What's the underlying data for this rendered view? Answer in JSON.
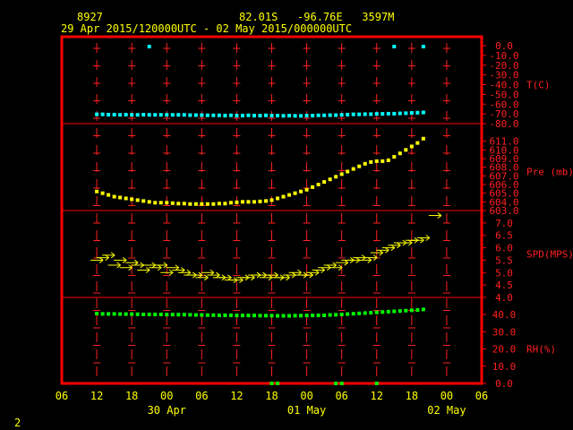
{
  "header": {
    "station": "8927",
    "location": "82.01S   -96.76E   3597M",
    "period": "29 Apr 2015/120000UTC - 02 May 2015/000000UTC"
  },
  "footer": {
    "page_number": "2"
  },
  "chart_data": {
    "type": "scatter",
    "x_axis": {
      "unit": "hours from 29 Apr 2015 06 UTC",
      "range": [
        0,
        72
      ],
      "tick_labels": [
        {
          "h": 0,
          "label": "06"
        },
        {
          "h": 6,
          "label": "12"
        },
        {
          "h": 12,
          "label": "18"
        },
        {
          "h": 18,
          "label": "00"
        },
        {
          "h": 24,
          "label": "06"
        },
        {
          "h": 30,
          "label": "12"
        },
        {
          "h": 36,
          "label": "18"
        },
        {
          "h": 42,
          "label": "00"
        },
        {
          "h": 48,
          "label": "06"
        },
        {
          "h": 54,
          "label": "12"
        },
        {
          "h": 60,
          "label": "18"
        },
        {
          "h": 66,
          "label": "00"
        },
        {
          "h": 72,
          "label": "06"
        }
      ],
      "date_labels": [
        {
          "h": 18,
          "label": "30 Apr"
        },
        {
          "h": 42,
          "label": "01 May"
        },
        {
          "h": 66,
          "label": "02 May"
        }
      ]
    },
    "panels": [
      {
        "id": "temp",
        "label": "T(C)",
        "color": "#00ffff",
        "ylim": [
          -80,
          0
        ],
        "tick_labels": [
          "0.0",
          "-10.0",
          "-20.0",
          "-30.0",
          "-40.0",
          "-50.0",
          "-60.0",
          "-70.0",
          "-80.0"
        ],
        "tick_values": [
          0,
          -10,
          -20,
          -30,
          -40,
          -50,
          -60,
          -70,
          -80
        ],
        "values": [
          [
            6,
            -70.5
          ],
          [
            7,
            -70.5
          ],
          [
            8,
            -70.8
          ],
          [
            9,
            -70.8
          ],
          [
            10,
            -71
          ],
          [
            11,
            -70.8
          ],
          [
            12,
            -71
          ],
          [
            13,
            -71
          ],
          [
            14,
            -70.8
          ],
          [
            15,
            -71
          ],
          [
            16,
            -71
          ],
          [
            17,
            -71
          ],
          [
            18,
            -71
          ],
          [
            19,
            -71
          ],
          [
            20,
            -71
          ],
          [
            21,
            -71
          ],
          [
            22,
            -71.3
          ],
          [
            23,
            -71.3
          ],
          [
            24,
            -71.3
          ],
          [
            25,
            -71.5
          ],
          [
            26,
            -71.5
          ],
          [
            27,
            -71.5
          ],
          [
            28,
            -71.8
          ],
          [
            29,
            -71.5
          ],
          [
            30,
            -71.8
          ],
          [
            31,
            -71.8
          ],
          [
            32,
            -71.5
          ],
          [
            33,
            -71.8
          ],
          [
            34,
            -71.8
          ],
          [
            35,
            -71.5
          ],
          [
            36,
            -71.8
          ],
          [
            37,
            -71.8
          ],
          [
            38,
            -72
          ],
          [
            39,
            -71.8
          ],
          [
            40,
            -72
          ],
          [
            41,
            -72
          ],
          [
            42,
            -71.8
          ],
          [
            43,
            -71.8
          ],
          [
            44,
            -71.5
          ],
          [
            45,
            -71.5
          ],
          [
            46,
            -71.3
          ],
          [
            47,
            -71.3
          ],
          [
            48,
            -71
          ],
          [
            49,
            -70.8
          ],
          [
            50,
            -70.5
          ],
          [
            51,
            -70.5
          ],
          [
            52,
            -70.3
          ],
          [
            53,
            -70.3
          ],
          [
            54,
            -70
          ],
          [
            55,
            -70
          ],
          [
            56,
            -69.8
          ],
          [
            57,
            -69.8
          ],
          [
            58,
            -69.5
          ],
          [
            59,
            -69.3
          ],
          [
            60,
            -69
          ],
          [
            61,
            -68.8
          ],
          [
            62,
            -68.5
          ]
        ],
        "top_markers": [
          15,
          57,
          62
        ]
      },
      {
        "id": "pres",
        "label": "Pre (mb)",
        "color": "#ffff00",
        "ylim": [
          603,
          612
        ],
        "tick_labels": [
          "611.0",
          "610.0",
          "609.0",
          "608.0",
          "607.0",
          "606.0",
          "605.0",
          "604.0",
          "603.0"
        ],
        "tick_values": [
          611,
          610,
          609,
          608,
          607,
          606,
          605,
          604,
          603
        ],
        "values": [
          [
            6,
            605.2
          ],
          [
            7,
            605
          ],
          [
            8,
            604.8
          ],
          [
            9,
            604.6
          ],
          [
            10,
            604.5
          ],
          [
            11,
            604.4
          ],
          [
            12,
            604.3
          ],
          [
            13,
            604.2
          ],
          [
            14,
            604.1
          ],
          [
            15,
            604
          ],
          [
            16,
            603.9
          ],
          [
            17,
            603.9
          ],
          [
            18,
            603.9
          ],
          [
            19,
            603.85
          ],
          [
            20,
            603.8
          ],
          [
            21,
            603.8
          ],
          [
            22,
            603.75
          ],
          [
            23,
            603.75
          ],
          [
            24,
            603.75
          ],
          [
            25,
            603.75
          ],
          [
            26,
            603.75
          ],
          [
            27,
            603.8
          ],
          [
            28,
            603.8
          ],
          [
            29,
            603.9
          ],
          [
            30,
            603.95
          ],
          [
            31,
            604
          ],
          [
            32,
            604
          ],
          [
            33,
            604
          ],
          [
            34,
            604.05
          ],
          [
            35,
            604.1
          ],
          [
            36,
            604.2
          ],
          [
            37,
            604.4
          ],
          [
            38,
            604.6
          ],
          [
            39,
            604.8
          ],
          [
            40,
            605
          ],
          [
            41,
            605.2
          ],
          [
            42,
            605.4
          ],
          [
            43,
            605.7
          ],
          [
            44,
            606
          ],
          [
            45,
            606.3
          ],
          [
            46,
            606.6
          ],
          [
            47,
            606.9
          ],
          [
            48,
            607.2
          ],
          [
            49,
            607.5
          ],
          [
            50,
            607.8
          ],
          [
            51,
            608.1
          ],
          [
            52,
            608.4
          ],
          [
            53,
            608.6
          ],
          [
            54,
            608.7
          ],
          [
            55,
            608.7
          ],
          [
            56,
            608.8
          ],
          [
            57,
            609.2
          ],
          [
            58,
            609.6
          ],
          [
            59,
            610
          ],
          [
            60,
            610.4
          ],
          [
            61,
            610.8
          ],
          [
            62,
            611.3
          ]
        ]
      },
      {
        "id": "wind",
        "label": "SPD(MPS)",
        "color": "#ffff00",
        "ylim": [
          4,
          7.5
        ],
        "tick_labels": [
          "7.0",
          "6.5",
          "6.0",
          "5.5",
          "5.0",
          "4.5",
          "4.0"
        ],
        "tick_values": [
          7,
          6.5,
          6,
          5.5,
          5,
          4.5,
          4
        ],
        "values": [
          [
            6,
            5.5
          ],
          [
            7,
            5.6
          ],
          [
            8,
            5.7
          ],
          [
            9,
            5.3
          ],
          [
            10,
            5.5
          ],
          [
            11,
            5.2
          ],
          [
            12,
            5.4
          ],
          [
            13,
            5.3
          ],
          [
            14,
            5.1
          ],
          [
            15,
            5.3
          ],
          [
            16,
            5.2
          ],
          [
            17,
            5.3
          ],
          [
            18,
            5.0
          ],
          [
            19,
            5.2
          ],
          [
            20,
            5.1
          ],
          [
            21,
            5.0
          ],
          [
            22,
            4.9
          ],
          [
            23,
            4.9
          ],
          [
            24,
            4.8
          ],
          [
            25,
            5.0
          ],
          [
            26,
            4.9
          ],
          [
            27,
            4.8
          ],
          [
            28,
            4.8
          ],
          [
            29,
            4.7
          ],
          [
            30,
            4.7
          ],
          [
            31,
            4.8
          ],
          [
            32,
            4.8
          ],
          [
            33,
            4.9
          ],
          [
            34,
            4.9
          ],
          [
            35,
            4.8
          ],
          [
            36,
            4.9
          ],
          [
            37,
            4.8
          ],
          [
            38,
            4.8
          ],
          [
            39,
            4.9
          ],
          [
            40,
            5.0
          ],
          [
            41,
            4.9
          ],
          [
            42,
            4.9
          ],
          [
            43,
            5.0
          ],
          [
            44,
            5.1
          ],
          [
            45,
            5.2
          ],
          [
            46,
            5.3
          ],
          [
            47,
            5.2
          ],
          [
            48,
            5.4
          ],
          [
            49,
            5.5
          ],
          [
            50,
            5.5
          ],
          [
            51,
            5.6
          ],
          [
            52,
            5.5
          ],
          [
            53,
            5.6
          ],
          [
            54,
            5.8
          ],
          [
            55,
            5.9
          ],
          [
            56,
            6.0
          ],
          [
            57,
            6.1
          ],
          [
            58,
            6.2
          ],
          [
            59,
            6.2
          ],
          [
            60,
            6.3
          ],
          [
            61,
            6.3
          ],
          [
            62,
            6.4
          ],
          [
            64,
            7.3
          ]
        ]
      },
      {
        "id": "rh",
        "label": "RH(%)",
        "color": "#00ff00",
        "ylim": [
          0,
          40
        ],
        "tick_labels": [
          "40.0",
          "30.0",
          "20.0",
          "10.0",
          "0.0"
        ],
        "tick_values": [
          40,
          30,
          20,
          10,
          0
        ],
        "values": [
          [
            6,
            40.5
          ],
          [
            7,
            40.3
          ],
          [
            8,
            40.3
          ],
          [
            9,
            40.3
          ],
          [
            10,
            40.2
          ],
          [
            11,
            40.2
          ],
          [
            12,
            40.2
          ],
          [
            13,
            40.1
          ],
          [
            14,
            40
          ],
          [
            15,
            40
          ],
          [
            16,
            40
          ],
          [
            17,
            40
          ],
          [
            18,
            39.9
          ],
          [
            19,
            39.9
          ],
          [
            20,
            39.9
          ],
          [
            21,
            39.9
          ],
          [
            22,
            39.8
          ],
          [
            23,
            39.7
          ],
          [
            24,
            39.7
          ],
          [
            25,
            39.6
          ],
          [
            26,
            39.6
          ],
          [
            27,
            39.5
          ],
          [
            28,
            39.5
          ],
          [
            29,
            39.5
          ],
          [
            30,
            39.4
          ],
          [
            31,
            39.4
          ],
          [
            32,
            39.4
          ],
          [
            33,
            39.4
          ],
          [
            34,
            39.3
          ],
          [
            35,
            39.3
          ],
          [
            36,
            39.3
          ],
          [
            37,
            39.2
          ],
          [
            38,
            39.2
          ],
          [
            39,
            39.2
          ],
          [
            40,
            39.3
          ],
          [
            41,
            39.3
          ],
          [
            42,
            39.4
          ],
          [
            43,
            39.4
          ],
          [
            44,
            39.5
          ],
          [
            45,
            39.5
          ],
          [
            46,
            39.7
          ],
          [
            47,
            39.8
          ],
          [
            48,
            40
          ],
          [
            49,
            40.2
          ],
          [
            50,
            40.4
          ],
          [
            51,
            40.6
          ],
          [
            52,
            40.8
          ],
          [
            53,
            41
          ],
          [
            54,
            41.2
          ],
          [
            55,
            41.4
          ],
          [
            56,
            41.6
          ],
          [
            57,
            41.8
          ],
          [
            58,
            42
          ],
          [
            59,
            42.2
          ],
          [
            60,
            42.4
          ],
          [
            61,
            42.6
          ],
          [
            62,
            42.9
          ]
        ],
        "bottom_markers": [
          36,
          37,
          47,
          48,
          54
        ]
      }
    ]
  }
}
